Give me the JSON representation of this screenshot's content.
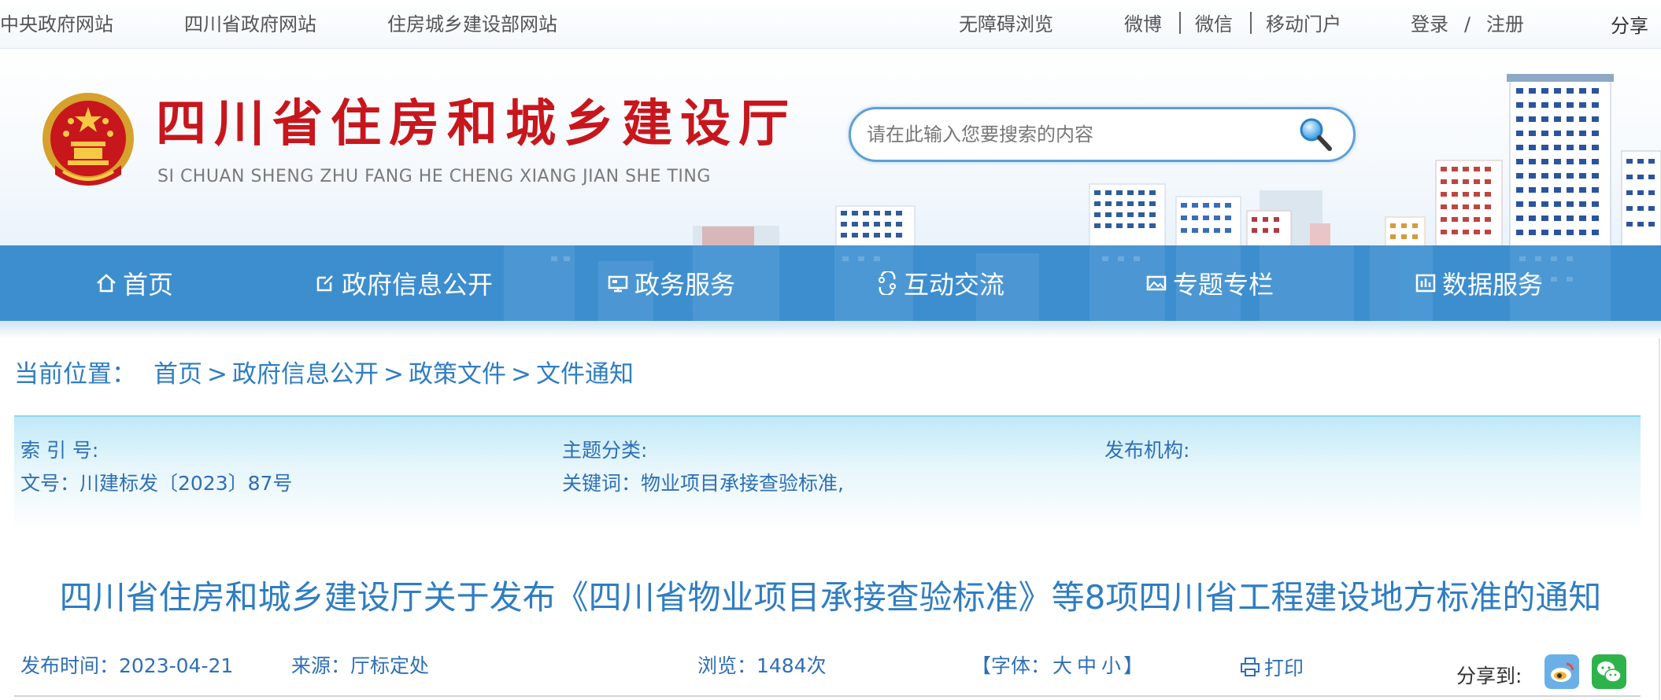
{
  "topbar": {
    "left_links": [
      "中央政府网站",
      "四川省政府网站",
      "住房城乡建设部网站"
    ],
    "accessibility": "无障碍浏览",
    "social": [
      "微博",
      "微信",
      "移动门户"
    ],
    "login": "登录",
    "slash": "/",
    "register": "注册",
    "share": "分享"
  },
  "header": {
    "title": "四川省住房和城乡建设厅",
    "subtitle": "SI CHUAN SHENG ZHU FANG HE CHENG XIANG JIAN SHE TING",
    "search_placeholder": "请在此输入您要搜索的内容"
  },
  "nav": {
    "items": [
      {
        "label": "首页",
        "icon": "home-icon"
      },
      {
        "label": "政府信息公开",
        "icon": "edit-icon"
      },
      {
        "label": "政务服务",
        "icon": "monitor-icon"
      },
      {
        "label": "互动交流",
        "icon": "chat-icon"
      },
      {
        "label": "专题专栏",
        "icon": "image-icon"
      },
      {
        "label": "数据服务",
        "icon": "chart-icon"
      }
    ]
  },
  "breadcrumb": {
    "label": "当前位置：",
    "items": [
      "首页",
      "政府信息公开",
      "政策文件",
      "文件通知"
    ],
    "separator": ">"
  },
  "meta": {
    "index_no": "索 引 号:",
    "topic": "主题分类:",
    "publisher": "发布机构:",
    "doc_no": "文号：川建标发〔2023〕87号",
    "keywords": "关键词：物业项目承接查验标准,"
  },
  "article": {
    "title": "四川省住房和城乡建设厅关于发布《四川省物业项目承接查验标准》等8项四川省工程建设地方标准的通知",
    "publish_time": "发布时间：2023-04-21",
    "source": "来源：厅标定处",
    "views": "浏览：1484次",
    "font_prefix": "【字体：",
    "font_large": "大",
    "font_medium": "中",
    "font_small": "小",
    "font_suffix": "】",
    "print": "打印",
    "share_to": "分享到:"
  },
  "colors": {
    "brand_red": "#c8161d",
    "nav_blue": "#3d8ecf",
    "link_blue": "#2f7dc2"
  }
}
